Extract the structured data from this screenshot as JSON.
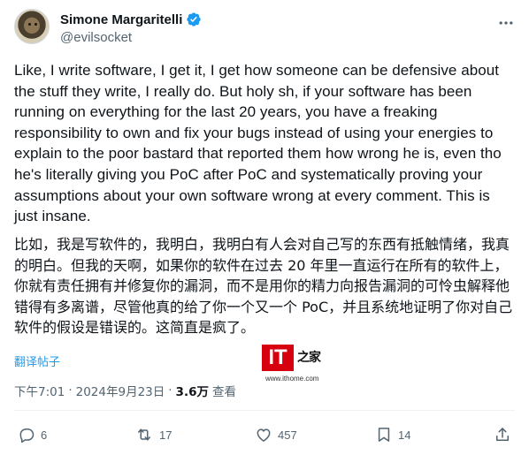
{
  "author": {
    "display_name": "Simone Margaritelli",
    "handle": "@evilsocket",
    "verified": true
  },
  "tweet": {
    "text_en": "Like, I write software, I get it, I get how someone can be defensive about the stuff they write, I really do. But holy sh, if your software has been running on everything for the last 20 years, you have a freaking responsibility to own and fix your bugs instead of using your energies to explain to the poor bastard that reported them how wrong he is, even tho he's literally giving you PoC after PoC and systematically proving your assumptions about your own software wrong at every comment. This is just insane.",
    "text_zh": "比如，我是写软件的，我明白，我明白有人会对自己写的东西有抵触情绪，我真的明白。但我的天啊，如果你的软件在过去 20 年里一直运行在所有的软件上，你就有责任拥有并修复你的漏洞，而不是用你的精力向报告漏洞的可怜虫解释他错得有多离谱，尽管他真的给了你一个又一个 PoC，并且系统地证明了你对自己软件的假设是错误的。这简直是疯了。",
    "translate_label": "翻译帖子"
  },
  "watermark": {
    "logo_it": "IT",
    "logo_zhi": "之家",
    "url": "www.ithome.com"
  },
  "meta": {
    "time": "下午7:01",
    "separator": "·",
    "date": "2024年9月23日",
    "views_count": "3.6万",
    "views_label": "查看"
  },
  "actions": {
    "replies": "6",
    "retweets": "17",
    "likes": "457",
    "bookmarks": "14"
  },
  "icons": {
    "verified": "verified-badge-icon",
    "more": "more-options-icon",
    "reply": "reply-icon",
    "retweet": "retweet-icon",
    "like": "heart-icon",
    "bookmark": "bookmark-icon",
    "share": "share-icon"
  },
  "colors": {
    "accent": "#1d9bf0",
    "text": "#0f1419",
    "muted": "#536471",
    "divider": "#eff3f4"
  }
}
